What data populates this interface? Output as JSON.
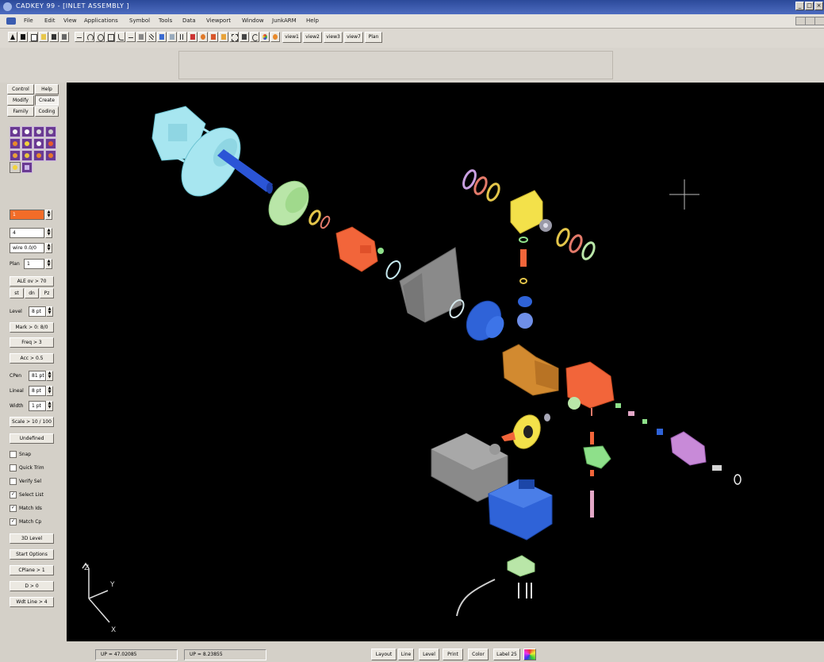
{
  "window": {
    "title": "CADKEY 99 - [INLET ASSEMBLY ]",
    "minimize": "_",
    "maximize": "□",
    "close": "×"
  },
  "menu": [
    "File",
    "Edit",
    "View",
    "Applications",
    "Symbol",
    "Tools",
    "Data",
    "Viewport",
    "Window",
    "JunkARM",
    "Help"
  ],
  "toolbar": {
    "icons": [
      "arrow-up-icon",
      "pointer-icon",
      "new-file-icon",
      "open-file-icon",
      "save-icon",
      "print-icon",
      "line-icon",
      "arc-icon",
      "circle-icon",
      "polygon-icon",
      "fillet-icon",
      "dimension-icon",
      "measure-icon",
      "hatch-icon",
      "text-icon",
      "layer-icon",
      "grid-icon",
      "pointer-select-icon",
      "shade-icon",
      "shade-solid-icon",
      "render-icon",
      "zoom-window-icon",
      "zoom-all-icon",
      "rotate-icon",
      "palette-icon",
      "light-icon"
    ],
    "view_buttons": [
      "view1",
      "view2",
      "view3",
      "view7",
      "Plan"
    ]
  },
  "left_panel": {
    "tabs": [
      "Control",
      "Help",
      "Modify",
      "Create",
      "Family",
      "Coding"
    ],
    "icon_grid": [
      "select-icon",
      "zoom-icon",
      "pan-icon",
      "rotate-view-icon",
      "shade-ball-icon",
      "light-bulb-icon",
      "color-icon",
      "cube-icon",
      "star-icon",
      "sphere-icon",
      "wave-icon"
    ],
    "spin_1": "1",
    "spin_2": "4",
    "spin_3": "wire 0.0/0",
    "spin_4_label": "Plan",
    "spin_4": "1",
    "row_1": "ALE ov > 70",
    "row_2_buttons": [
      "st",
      "dn",
      "Pz"
    ],
    "level_label": "Level",
    "level_value": "8 pt",
    "row_3": "Mark > 0: 8/0",
    "row_4": "Freq > 3",
    "row_5": "Acc > 0.5",
    "color_label": "CPen",
    "color_value": "81 pt",
    "lineal_label": "Lineal",
    "lineal_value": "8 pt",
    "width_label": "Width",
    "width_value": "1 pt",
    "row_6": "Scale > 10 / 100",
    "row_7": "Undefined",
    "checkboxes": [
      {
        "label": "Snap",
        "checked": false
      },
      {
        "label": "Quick Trim",
        "checked": false
      },
      {
        "label": "Verify Sel",
        "checked": false
      },
      {
        "label": "Select List",
        "checked": true
      },
      {
        "label": "Match Ids",
        "checked": true
      },
      {
        "label": "Match Cp",
        "checked": true
      }
    ],
    "bottom_buttons": [
      "3D Level",
      "Start Options",
      "CPlane > 1",
      "D > 0",
      "Wdt Line > 4"
    ]
  },
  "viewport": {
    "axis_labels": {
      "z": "Z",
      "y": "Y",
      "x": "X"
    }
  },
  "statusbar": {
    "field_1": "UP = 47.02085",
    "field_2": "UP = 8.23855",
    "buttons": [
      "Layout",
      "Line",
      "Level",
      "Print",
      "Color",
      "Label 25"
    ]
  }
}
